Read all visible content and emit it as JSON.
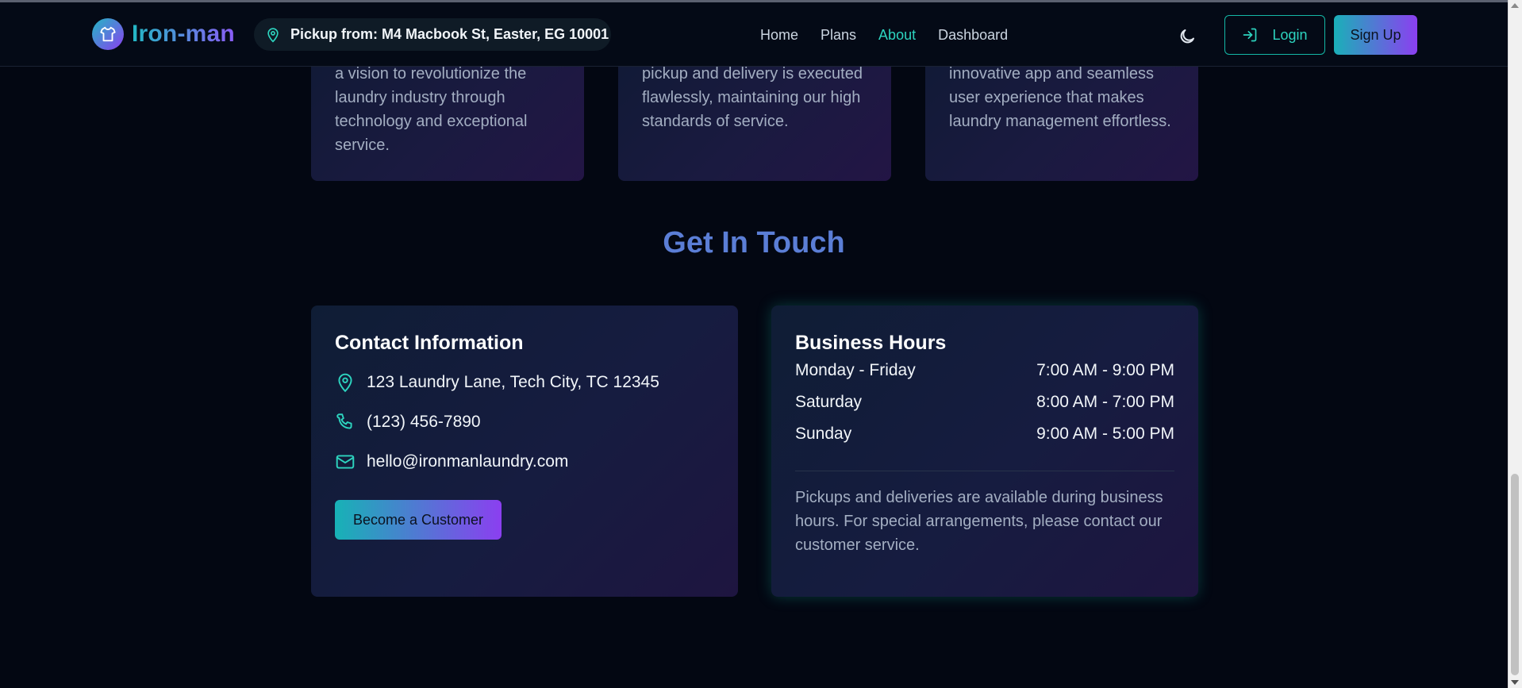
{
  "nav": {
    "brand": "Iron-man",
    "pickup": "Pickup from: M4 Macbook St, Easter, EG 10001",
    "links": [
      {
        "label": "Home",
        "active": false
      },
      {
        "label": "Plans",
        "active": false
      },
      {
        "label": "About",
        "active": true
      },
      {
        "label": "Dashboard",
        "active": false
      }
    ],
    "login_label": "Login",
    "signup_label": "Sign Up",
    "icons": {
      "logo": "shirt-icon",
      "pickup": "map-pin-icon",
      "theme": "moon-icon",
      "login": "log-in-icon"
    }
  },
  "top_cards": [
    {
      "text": "a vision to revolutionize the laundry industry through technology and exceptional service."
    },
    {
      "text": "pickup and delivery is executed flawlessly, maintaining our high standards of service."
    },
    {
      "text": "innovative app and seamless user experience that makes laundry management effortless."
    }
  ],
  "section": {
    "title": "Get In Touch"
  },
  "contact": {
    "title": "Contact Information",
    "address": "123 Laundry Lane, Tech City, TC 12345",
    "phone": "(123) 456-7890",
    "email": "hello@ironmanlaundry.com",
    "cta_label": "Become a Customer"
  },
  "hours": {
    "title": "Business Hours",
    "rows": [
      {
        "day": "Monday - Friday",
        "time": "7:00 AM - 9:00 PM"
      },
      {
        "day": "Saturday",
        "time": "8:00 AM - 7:00 PM"
      },
      {
        "day": "Sunday",
        "time": "9:00 AM - 5:00 PM"
      }
    ],
    "note": "Pickups and deliveries are available during business hours. For special arrangements, please contact our customer service."
  },
  "colors": {
    "background": "#030712",
    "accent_teal": "#2dd4bf",
    "accent_purple": "#8b3ff0",
    "title_blue": "#5b7ed6"
  }
}
